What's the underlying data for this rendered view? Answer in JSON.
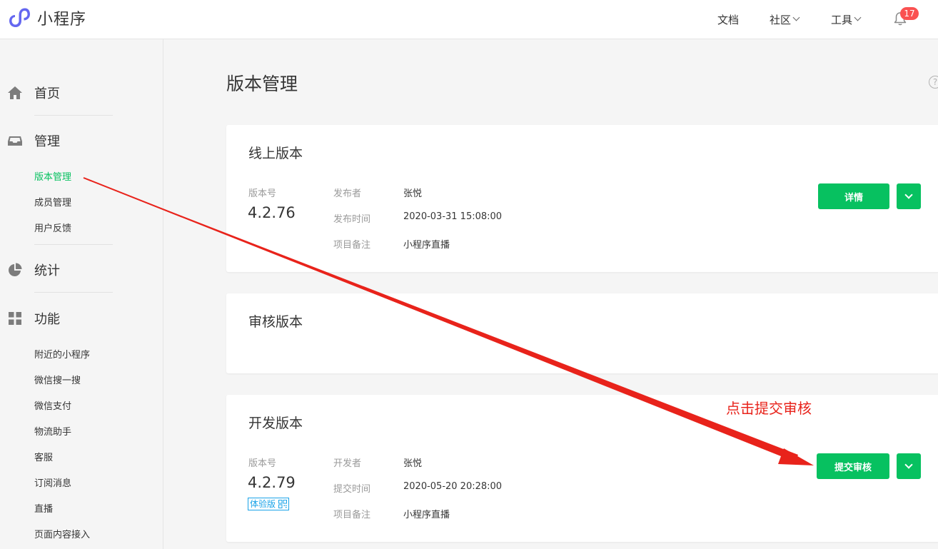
{
  "header": {
    "brand": "小程序",
    "nav": [
      {
        "label": "文档",
        "has_dropdown": false
      },
      {
        "label": "社区",
        "has_dropdown": true
      },
      {
        "label": "工具",
        "has_dropdown": true
      }
    ],
    "notification_count": "17"
  },
  "sidebar": {
    "home_label": "首页",
    "manage_label": "管理",
    "manage_items": [
      "版本管理",
      "成员管理",
      "用户反馈"
    ],
    "stats_label": "统计",
    "features_label": "功能",
    "feature_items": [
      "附近的小程序",
      "微信搜一搜",
      "微信支付",
      "物流助手",
      "客服",
      "订阅消息",
      "直播",
      "页面内容接入"
    ],
    "active_item": "版本管理"
  },
  "main": {
    "title": "版本管理",
    "help_icon": "?",
    "online": {
      "title": "线上版本",
      "version_label": "版本号",
      "version": "4.2.76",
      "meta": [
        {
          "key": "发布者",
          "value": "张悦"
        },
        {
          "key": "发布时间",
          "value": "2020-03-31 15:08:00"
        },
        {
          "key": "项目备注",
          "value": "小程序直播"
        }
      ],
      "button": "详情"
    },
    "review": {
      "title": "审核版本"
    },
    "dev": {
      "title": "开发版本",
      "version_label": "版本号",
      "version": "4.2.79",
      "tag": "体验版",
      "meta": [
        {
          "key": "开发者",
          "value": "张悦"
        },
        {
          "key": "提交时间",
          "value": "2020-05-20 20:28:00"
        },
        {
          "key": "项目备注",
          "value": "小程序直播"
        }
      ],
      "button": "提交审核"
    }
  },
  "annotation": {
    "text": "点击提交审核",
    "color": "#e8231b"
  },
  "colors": {
    "accent": "#07c160",
    "badge": "#fa5151",
    "tag": "#1aa3e8"
  }
}
